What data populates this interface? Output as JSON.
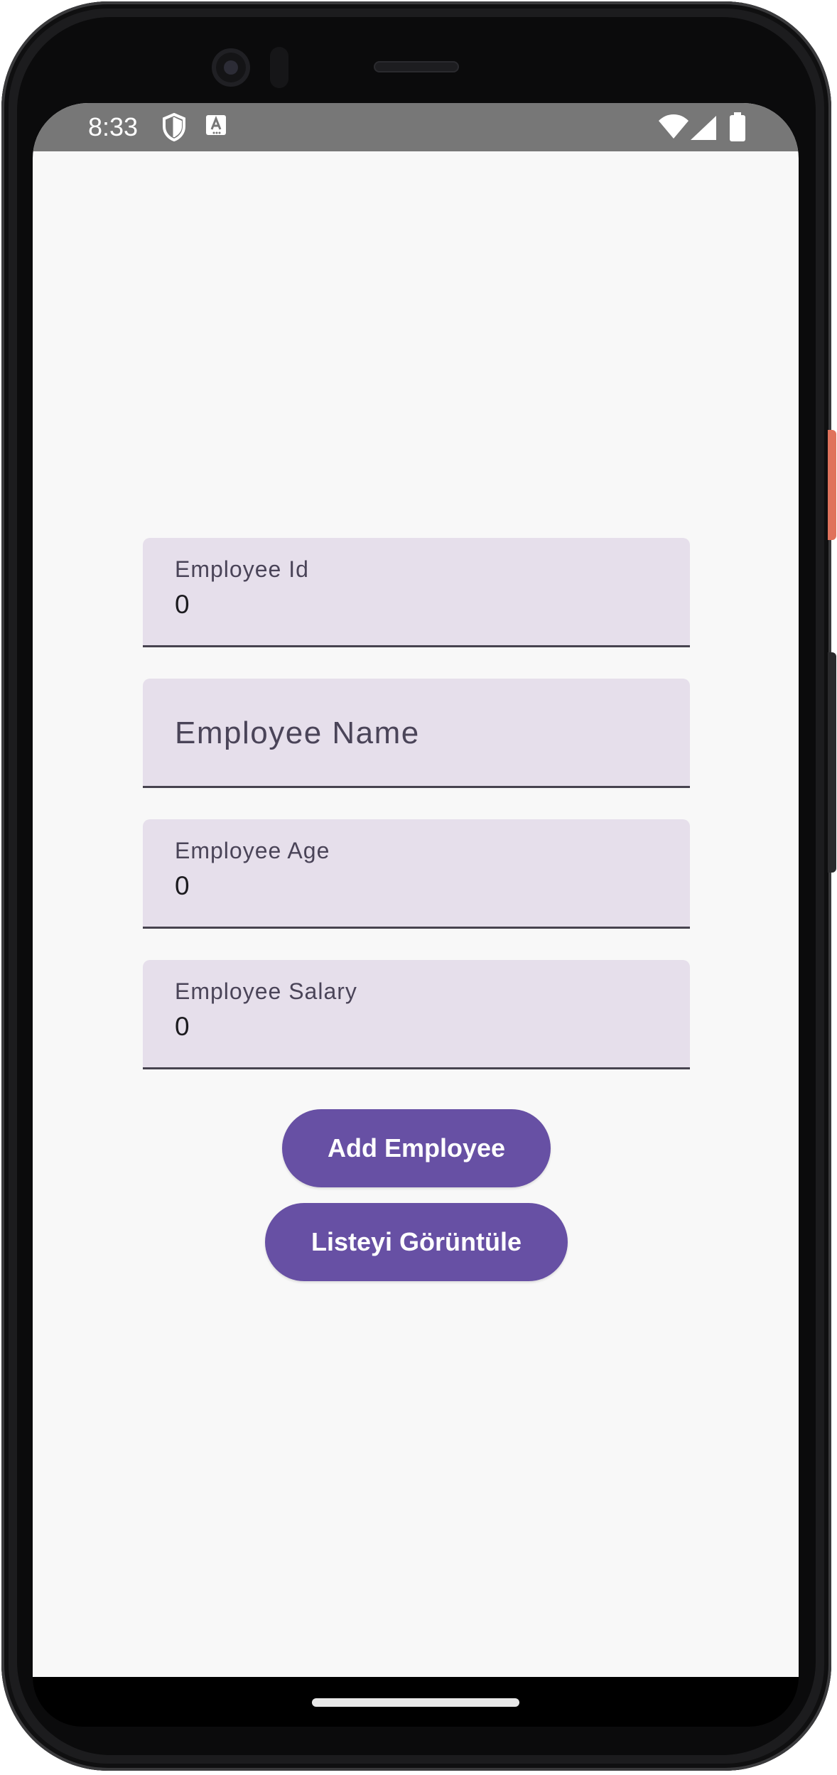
{
  "status_bar": {
    "time": "8:33",
    "icons": [
      "shield-icon",
      "a-icon",
      "wifi-icon",
      "signal-icon",
      "battery-icon"
    ]
  },
  "form": {
    "employee_id": {
      "label": "Employee Id",
      "value": "0"
    },
    "employee_name": {
      "placeholder": "Employee Name",
      "value": ""
    },
    "employee_age": {
      "label": "Employee Age",
      "value": "0"
    },
    "employee_salary": {
      "label": "Employee Salary",
      "value": "0"
    }
  },
  "buttons": {
    "add_employee": "Add Employee",
    "view_list": "Listeyi Görüntüle"
  },
  "colors": {
    "primary": "#6750a4",
    "field_background": "#e6dfeb",
    "screen_background": "#f8f8f8",
    "status_bar": "#777777"
  }
}
